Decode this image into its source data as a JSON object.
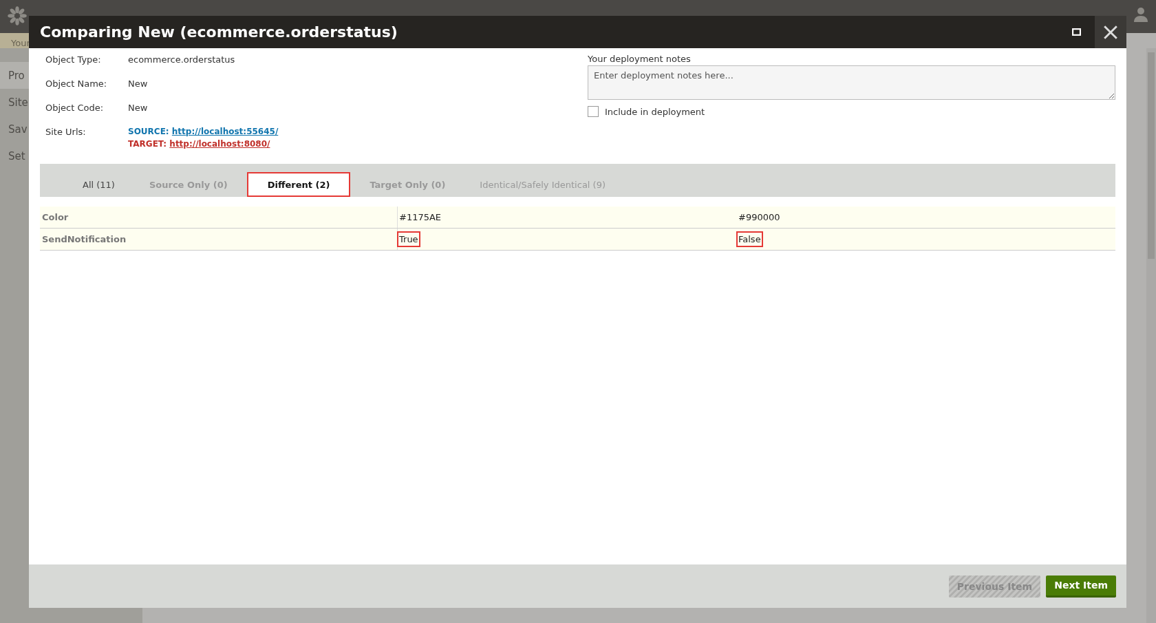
{
  "background": {
    "notice": "Your",
    "sidebar_items": [
      {
        "label": "Pro",
        "selected": true
      },
      {
        "label": "Site",
        "selected": false
      },
      {
        "label": "Sav",
        "selected": false
      },
      {
        "label": "Set",
        "selected": false
      }
    ]
  },
  "dialog": {
    "title": "Comparing New (ecommerce.orderstatus)",
    "details": [
      {
        "label": "Object Type:",
        "value": "ecommerce.orderstatus"
      },
      {
        "label": "Object Name:",
        "value": "New"
      },
      {
        "label": "Object Code:",
        "value": "New"
      }
    ],
    "site_urls": {
      "label": "Site Urls:",
      "source_label": "SOURCE:",
      "source_url": "http://localhost:55645/",
      "target_label": "TARGET:",
      "target_url": "http://localhost:8080/"
    },
    "notes": {
      "label": "Your deployment notes",
      "placeholder": "Enter deployment notes here..."
    },
    "include": {
      "label": "Include in deployment",
      "checked": false
    },
    "tabs": [
      {
        "label": "All (11)",
        "selected": false,
        "disabled": false
      },
      {
        "label": "Source Only (0)",
        "selected": false,
        "disabled": true
      },
      {
        "label": "Different (2)",
        "selected": true,
        "disabled": false
      },
      {
        "label": "Target Only (0)",
        "selected": false,
        "disabled": true
      },
      {
        "label": "Identical/Safely Identical (9)",
        "selected": false,
        "disabled": true
      }
    ],
    "rows": [
      {
        "field": "Color",
        "source": "#1175AE",
        "target": "#990000",
        "highlighted": false
      },
      {
        "field": "SendNotification",
        "source": "True",
        "target": "False",
        "highlighted": true
      }
    ],
    "buttons": [
      {
        "label": "Previous Item",
        "disabled": true
      },
      {
        "label": "Next Item",
        "disabled": false
      }
    ]
  }
}
